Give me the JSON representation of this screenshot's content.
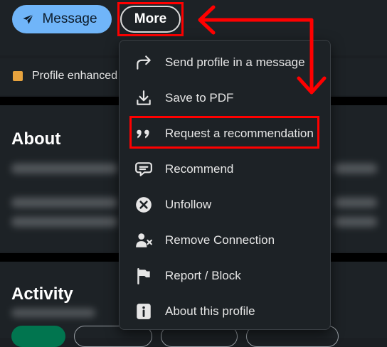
{
  "actions": {
    "message_label": "Message",
    "more_label": "More"
  },
  "banner": {
    "text": "Profile enhanced"
  },
  "about": {
    "title": "About"
  },
  "activity": {
    "title": "Activity"
  },
  "menu": {
    "items": [
      {
        "label": "Send profile in a message",
        "icon": "share-arrow-icon"
      },
      {
        "label": "Save to PDF",
        "icon": "download-icon"
      },
      {
        "label": "Request a recommendation",
        "icon": "quote-icon"
      },
      {
        "label": "Recommend",
        "icon": "speech-bubble-icon"
      },
      {
        "label": "Unfollow",
        "icon": "close-circle-icon"
      },
      {
        "label": "Remove Connection",
        "icon": "remove-person-icon"
      },
      {
        "label": "Report / Block",
        "icon": "flag-icon"
      },
      {
        "label": "About this profile",
        "icon": "info-icon"
      }
    ]
  },
  "colors": {
    "background": "#1b1f23",
    "panel": "#1d2226",
    "accent": "#70b5f9",
    "annotation": "#ff0000"
  }
}
